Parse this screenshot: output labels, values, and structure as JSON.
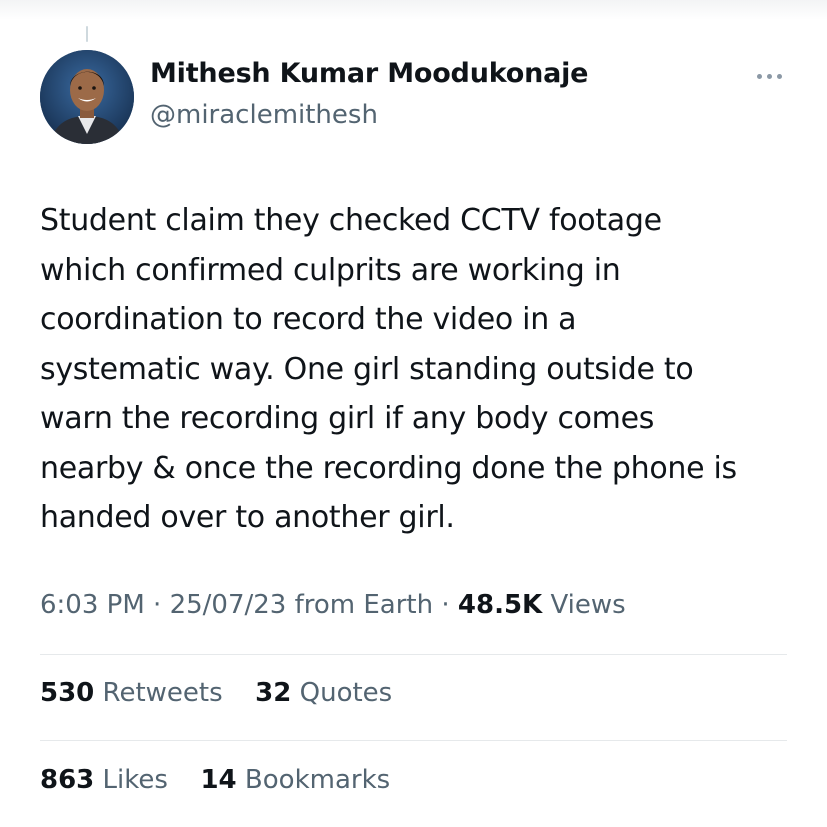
{
  "tweet": {
    "author_name": "Mithesh Kumar Moodukonaje",
    "author_handle": "@miraclemithesh",
    "text": "Student claim they checked CCTV footage\nwhich confirmed culprits are working in\ncoordination to record the video in a\nsystematic way. One girl standing outside to\nwarn the recording girl if any body comes\nnearby & once the recording done the phone is\nhanded over to another girl.",
    "time": "6:03 PM",
    "separator": "·",
    "date": "25/07/23",
    "source": "from Earth",
    "views_count": "48.5K",
    "views_label": "Views"
  },
  "stats": {
    "retweets_count": "530",
    "retweets_label": "Retweets",
    "quotes_count": "32",
    "quotes_label": "Quotes",
    "likes_count": "863",
    "likes_label": "Likes",
    "bookmarks_count": "14",
    "bookmarks_label": "Bookmarks"
  },
  "icons": {
    "more": "more-options-icon"
  },
  "colors": {
    "text": "#0f1419",
    "secondary": "#536471",
    "divider": "#e6e9eb"
  }
}
